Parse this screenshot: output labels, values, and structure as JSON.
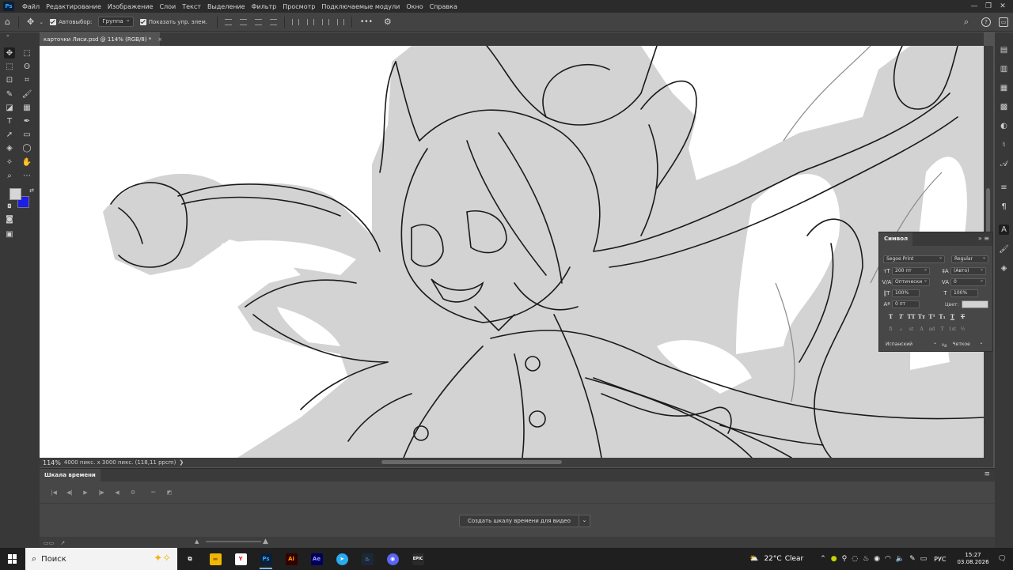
{
  "app": {
    "logo": "Ps",
    "menu": [
      "Файл",
      "Редактирование",
      "Изображение",
      "Слои",
      "Текст",
      "Выделение",
      "Фильтр",
      "Просмотр",
      "Подключаемые модули",
      "Окно",
      "Справка"
    ],
    "window_controls": [
      "—",
      "❐",
      "✕"
    ]
  },
  "options_bar": {
    "autoselect_label": "Автовыбор:",
    "autoselect_value": "Группа",
    "show_controls_label": "Показать упр. элем.",
    "more_label": "•••"
  },
  "document": {
    "tab_title": "карточки Лиси.psd @ 114% (RGB/8) *",
    "tab_close": "×"
  },
  "status": {
    "zoom": "114%",
    "info": "4000 пикс. x 3000 пикс. (118,11 ppcm)",
    "info_arrow": "❯"
  },
  "colors": {
    "foreground": "#d6d6d6",
    "background": "#1d1de8",
    "canvas_fill": "#d3d3d3",
    "line": "#1a1a1a"
  },
  "character_panel": {
    "title": "Символ",
    "font_family": "Segoe Print",
    "font_style": "Regular",
    "size": "200 пт",
    "leading": "(Авто)",
    "kerning": "Оптически",
    "tracking": "0",
    "vscale": "100%",
    "hscale": "100%",
    "baseline": "0 пт",
    "color_label": "Цвет:",
    "styles": [
      "T",
      "T",
      "TT",
      "Tт",
      "T¹",
      "T₁",
      "T",
      "T"
    ],
    "opentype": [
      "fi",
      "ℴ",
      "st",
      "A",
      "ad",
      "T",
      "1st",
      "½"
    ],
    "language": "Испанский",
    "aa_label": "ªa",
    "antialias": "Четкое"
  },
  "timeline": {
    "title": "Шкала времени",
    "create_button": "Создать шкалу времени для видео"
  },
  "taskbar": {
    "search_placeholder": "Поиск",
    "weather_temp": "22°C",
    "weather_text": "Clear",
    "language": "РУС",
    "time": "15:27",
    "date": "03.08.2026",
    "apps": [
      {
        "name": "task-view",
        "label": "⧉",
        "bg": "transparent",
        "fg": "#ffffff"
      },
      {
        "name": "file-explorer",
        "label": "▬",
        "bg": "#f2b705",
        "fg": "#a56d00"
      },
      {
        "name": "yandex-browser",
        "label": "Y",
        "bg": "#ffffff",
        "fg": "#ff0000"
      },
      {
        "name": "photoshop",
        "label": "Ps",
        "bg": "#0b1f3a",
        "fg": "#31a8ff"
      },
      {
        "name": "illustrator",
        "label": "Ai",
        "bg": "#330000",
        "fg": "#ff9a00"
      },
      {
        "name": "after-effects",
        "label": "Ae",
        "bg": "#00005b",
        "fg": "#9999ff"
      },
      {
        "name": "telegram",
        "label": "➤",
        "bg": "#2aabee",
        "fg": "#ffffff"
      },
      {
        "name": "steam",
        "label": "♨",
        "bg": "#1b2838",
        "fg": "#c7d5e0"
      },
      {
        "name": "discord",
        "label": "◉",
        "bg": "#5865f2",
        "fg": "#ffffff"
      },
      {
        "name": "epic-games",
        "label": "EPIC",
        "bg": "#2a2a2a",
        "fg": "#ffffff"
      }
    ]
  }
}
